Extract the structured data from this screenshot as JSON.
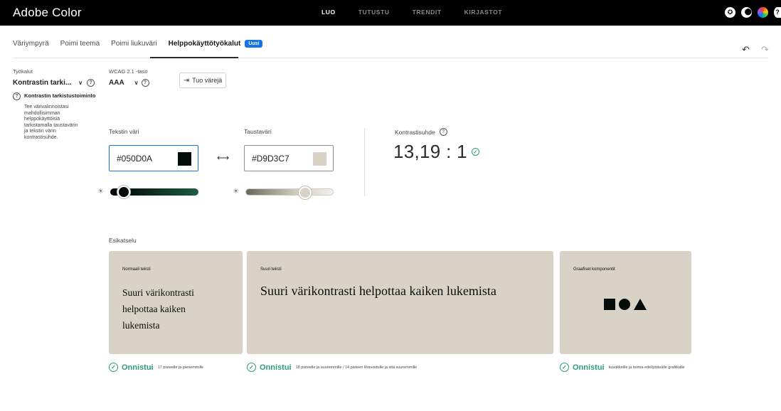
{
  "app": {
    "title": "Adobe Color"
  },
  "topnav": [
    {
      "label": "LUO",
      "active": true
    },
    {
      "label": "TUTUSTU",
      "active": false
    },
    {
      "label": "TRENDIT",
      "active": false
    },
    {
      "label": "KIRJASTOT",
      "active": false
    }
  ],
  "top_icons": [
    "creative-cloud-icon",
    "theme-toggle-icon",
    "color-wheel-icon",
    "help-icon"
  ],
  "subtabs": {
    "items": [
      "Väriympyrä",
      "Poimi teema",
      "Poimi liukuväri",
      "Helppokäyttötyökalut"
    ],
    "active": "Helppokäyttötyökalut",
    "badge": "Uusi"
  },
  "tools": {
    "label": "Työkalut",
    "value": "Kontrastin tarki...",
    "heading": "Kontrastin tarkistustoiminto",
    "description": "Tee värivalinnoistasi mahdollisimman helppokäyttöisiä tarkistamalla taustavärin ja tekstin värin kontrastisuhde."
  },
  "wcag": {
    "label": "WCAG 2.1 -taso",
    "value": "AAA"
  },
  "import_button": "Tuo värejä",
  "text_color": {
    "label": "Tekstin väri",
    "value": "#050D0A",
    "swatch": "#050D0A",
    "brightness": 0.15
  },
  "bg_color": {
    "label": "Taustaväri",
    "value": "#D9D3C7",
    "swatch": "#D9D3C7",
    "brightness": 0.68
  },
  "contrast": {
    "label": "Kontrastisuhde",
    "value": "13,19 : 1"
  },
  "preview": {
    "label": "Esikatselu",
    "background": "#D9D3C7",
    "foreground": "#050D0A",
    "cards": [
      {
        "label": "Normaali teksti",
        "text": "Suuri värikontrasti helpottaa kaiken lukemista"
      },
      {
        "label": "Suuri teksti",
        "text": "Suuri värikontrasti helpottaa kaiken lukemista"
      },
      {
        "label": "Graafiset komponentit"
      }
    ],
    "results": [
      {
        "status": "Onnistui",
        "desc": "17 pisteelle ja pienemmille"
      },
      {
        "status": "Onnistui",
        "desc": "18 pisteelle ja suuremmille / 14 pisteen lihavoidulle ja sitä suuremmille"
      },
      {
        "status": "Onnistui",
        "desc": "kuvakkeille ja toimia edellyttävälle grafiikalle"
      }
    ]
  },
  "colors": {
    "accent": "#1473e6",
    "success": "#2d9d78"
  }
}
